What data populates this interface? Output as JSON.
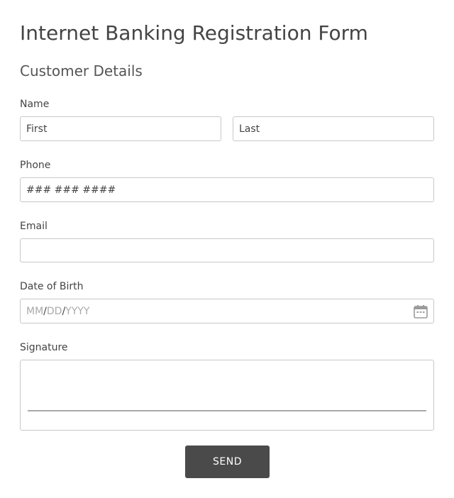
{
  "form": {
    "title": "Internet Banking Registration Form",
    "section_title": "Customer Details"
  },
  "fields": {
    "name": {
      "label": "Name",
      "first_placeholder": "First",
      "last_placeholder": "Last"
    },
    "phone": {
      "label": "Phone",
      "placeholder": "### ### ####"
    },
    "email": {
      "label": "Email",
      "value": ""
    },
    "dob": {
      "label": "Date of Birth",
      "month": "MM",
      "day": "DD",
      "year": "YYYY",
      "separator": "/",
      "icon": "calendar-icon"
    },
    "signature": {
      "label": "Signature"
    }
  },
  "actions": {
    "send_label": "SEND"
  },
  "colors": {
    "button_bg": "#4a4a4a",
    "border": "#c8c8c8",
    "text": "#444444",
    "muted": "#aaaaaa"
  }
}
